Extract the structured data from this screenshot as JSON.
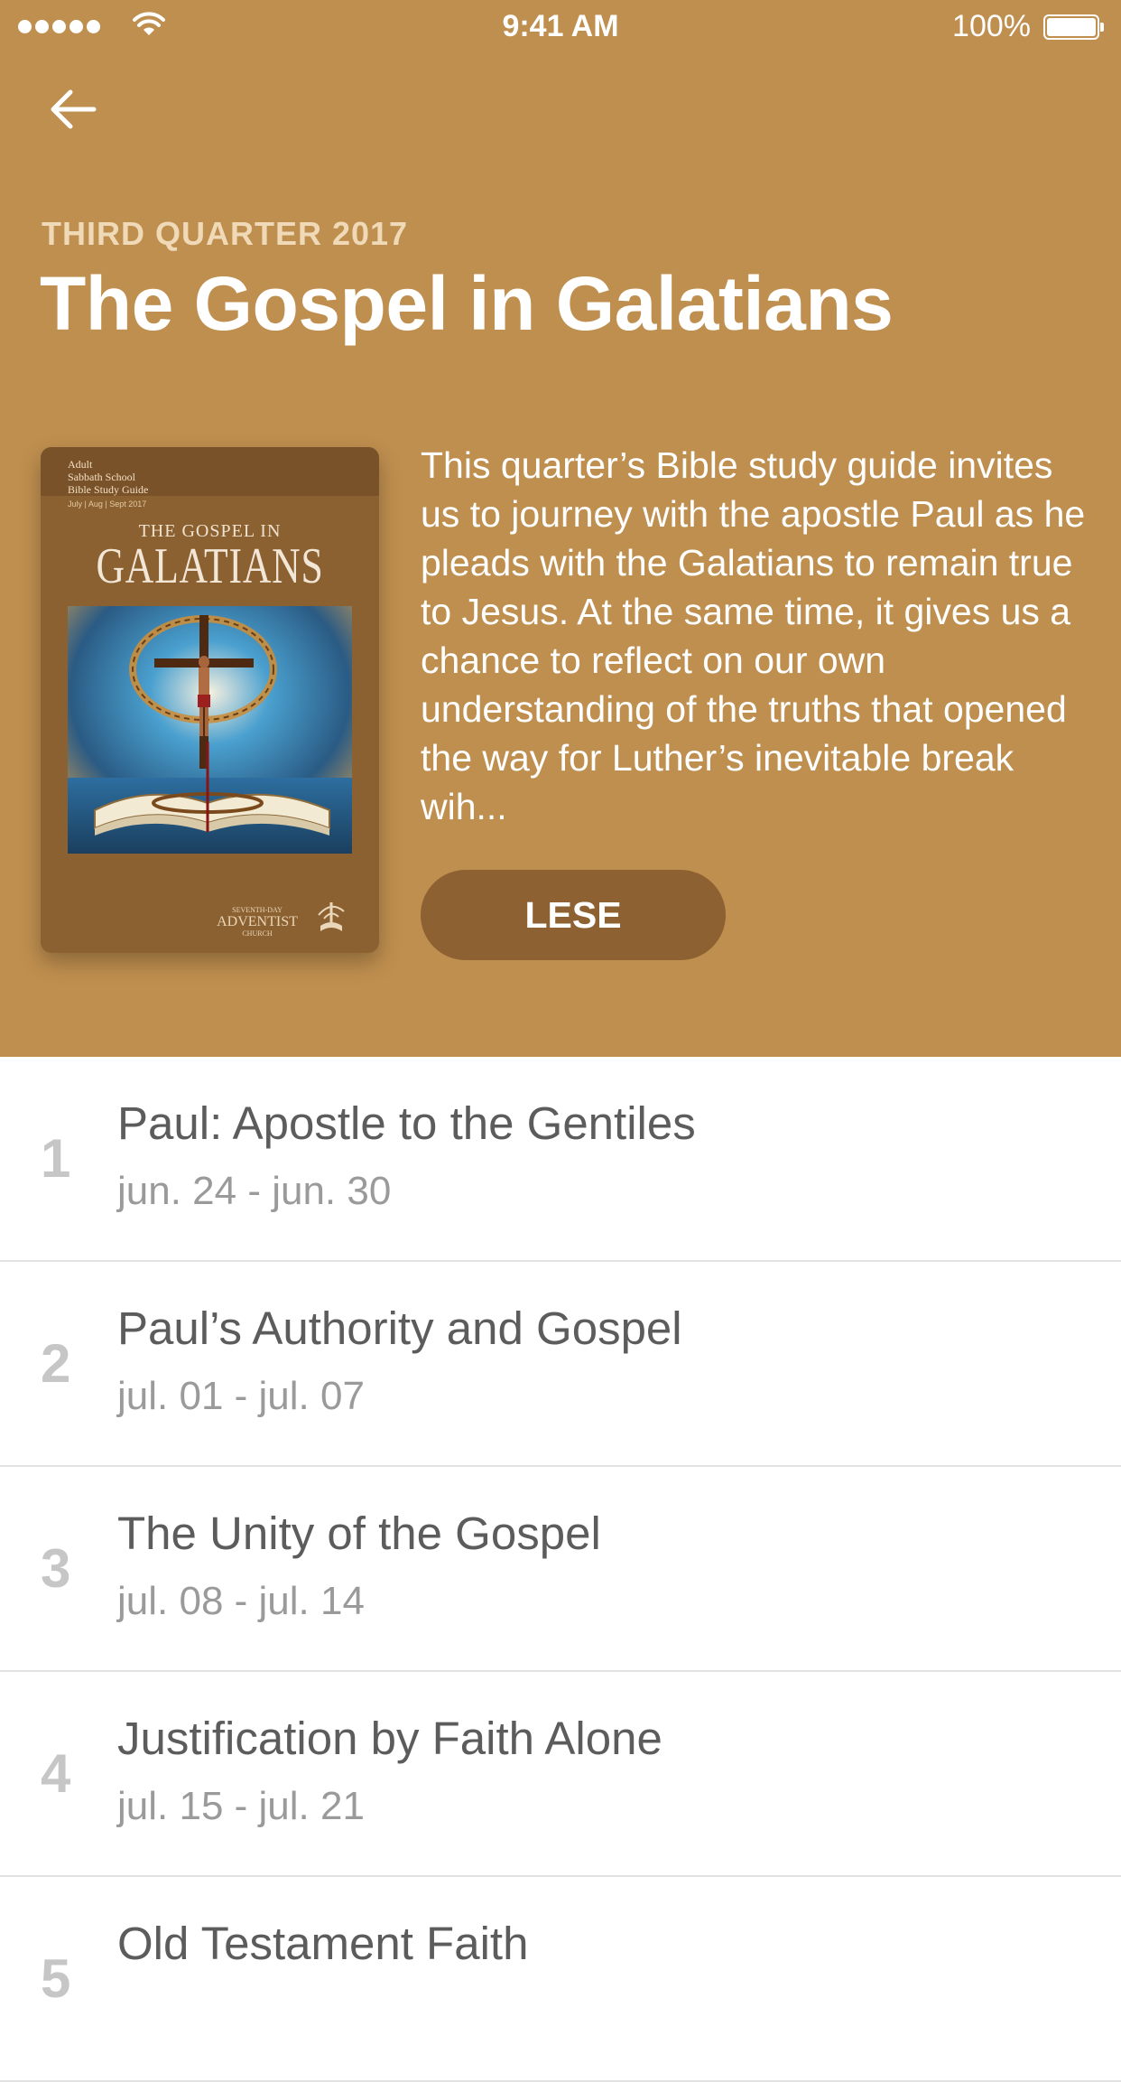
{
  "status_bar": {
    "time": "9:41 AM",
    "battery": "100%",
    "battery_level": 1.0,
    "signal_bars": 5
  },
  "header": {
    "background_color": "#bf8f4f",
    "back_icon": "arrow-left-icon",
    "quarter_label": "THIRD QUARTER 2017",
    "title": "The Gospel in Galatians",
    "description": "This quarter’s Bible study guide invites us to journey with the apostle Paul as he pleads with the Galatians to remain true to Jesus. At the same time, it gives us a chance to reflect on our own understanding of the truths that opened the way for Luther’s inevitable break wih...",
    "read_button": "LESE",
    "read_button_color": "#8d6131"
  },
  "cover": {
    "series_lines": [
      "Adult",
      "Sabbath School",
      "Bible Study Guide"
    ],
    "dates": "July | Aug | Sept 2017",
    "kicker": "THE GOSPEL IN",
    "main_title": "GALATIANS",
    "publisher_top": "SEVENTH-DAY",
    "publisher_main": "ADVENTIST",
    "publisher_bottom": "CHURCH"
  },
  "lessons": [
    {
      "number": "1",
      "title": "Paul: Apostle to the Gentiles",
      "dates": "jun. 24 - jun. 30"
    },
    {
      "number": "2",
      "title": "Paul’s Authority and Gospel",
      "dates": "jul. 01 - jul. 07"
    },
    {
      "number": "3",
      "title": "The Unity of the Gospel",
      "dates": "jul. 08 - jul. 14"
    },
    {
      "number": "4",
      "title": "Justification by Faith Alone",
      "dates": "jul. 15 - jul. 21"
    },
    {
      "number": "5",
      "title": "Old Testament Faith",
      "dates": ""
    }
  ]
}
